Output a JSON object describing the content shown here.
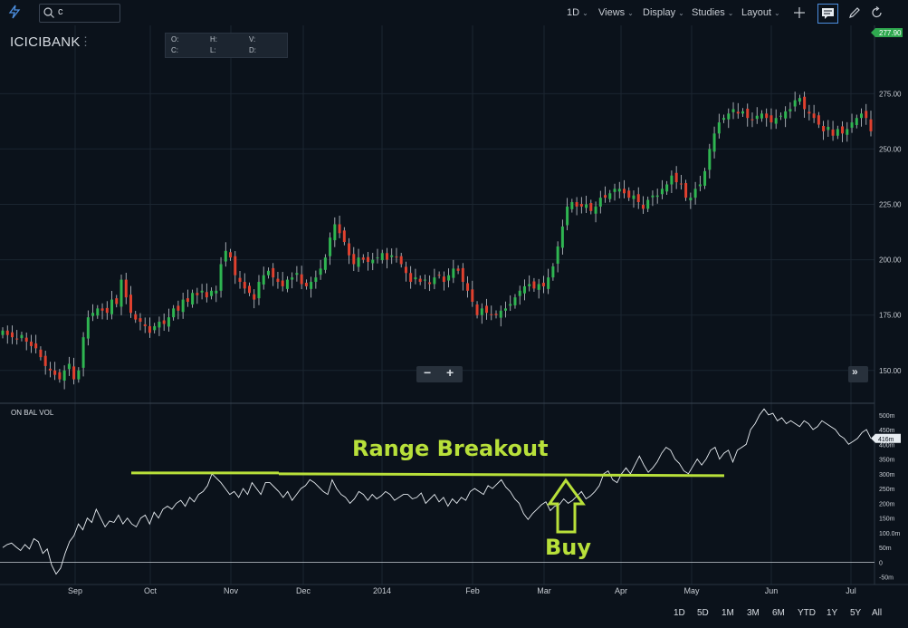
{
  "toolbar": {
    "search_value": "c",
    "interval_label": "1D",
    "views_label": "Views",
    "display_label": "Display",
    "studies_label": "Studies",
    "layout_label": "Layout"
  },
  "symbol": {
    "name": "ICICIBANK",
    "menu": "⋮"
  },
  "ohlc_labels": {
    "o": "O:",
    "h": "H:",
    "v": "V:",
    "c": "C:",
    "l": "L:",
    "d": "D:"
  },
  "indicator_label": "ON BAL VOL",
  "range_buttons": [
    "1D",
    "5D",
    "1M",
    "3M",
    "6M",
    "YTD",
    "1Y",
    "5Y",
    "All"
  ],
  "annotations": {
    "range_breakout": "Range Breakout",
    "buy": "Buy"
  },
  "colors": {
    "up": "#2fb551",
    "down": "#e0412f",
    "annotation": "#b8e03a",
    "last_price_badge": "#2fa84f",
    "background": "#0b121b"
  },
  "chart_data": [
    {
      "type": "candlestick",
      "title": "ICICIBANK",
      "x_tick_labels": [
        "Sep",
        "Oct",
        "Nov",
        "Dec",
        "2014",
        "Feb",
        "Mar",
        "Apr",
        "May",
        "Jun",
        "Jul"
      ],
      "y_tick_labels": [
        "150.00",
        "175.00",
        "200.00",
        "225.00",
        "250.00",
        "275.00"
      ],
      "ylim": [
        136,
        305
      ],
      "last_price_label": "277.90",
      "grid": true,
      "closes": [
        168,
        166,
        165,
        164,
        166,
        163,
        161,
        160,
        156,
        152,
        150,
        148,
        146,
        150,
        153,
        146,
        150,
        165,
        174,
        176,
        178,
        177,
        176,
        182,
        180,
        191,
        183,
        176,
        173,
        172,
        170,
        167,
        170,
        172,
        171,
        174,
        178,
        177,
        182,
        181,
        185,
        184,
        186,
        183,
        186,
        186,
        198,
        204,
        201,
        193,
        190,
        187,
        185,
        182,
        190,
        193,
        195,
        192,
        190,
        188,
        191,
        192,
        194,
        189,
        188,
        190,
        192,
        196,
        201,
        210,
        216,
        212,
        208,
        202,
        198,
        201,
        200,
        199,
        200,
        201,
        203,
        200,
        202,
        201,
        198,
        194,
        190,
        192,
        190,
        191,
        189,
        192,
        193,
        190,
        193,
        196,
        195,
        190,
        186,
        181,
        175,
        178,
        176,
        175,
        175,
        177,
        178,
        180,
        183,
        186,
        188,
        189,
        187,
        189,
        188,
        192,
        197,
        206,
        215,
        224,
        226,
        224,
        224,
        225,
        222,
        224,
        228,
        228,
        230,
        232,
        232,
        230,
        228,
        229,
        226,
        223,
        227,
        229,
        229,
        232,
        234,
        238,
        235,
        234,
        228,
        228,
        232,
        234,
        240,
        250,
        257,
        262,
        264,
        266,
        268,
        266,
        267,
        264,
        263,
        265,
        266,
        264,
        262,
        264,
        265,
        267,
        268,
        272,
        273,
        268,
        266,
        264,
        261,
        258,
        260,
        256,
        259,
        257,
        259,
        262,
        264,
        266,
        264,
        258
      ]
    },
    {
      "type": "line",
      "title": "ON BAL VOL",
      "y_tick_labels": [
        "-50m",
        "0",
        "50m",
        "100.0m",
        "150m",
        "200m",
        "250m",
        "300m",
        "350m",
        "400m",
        "450m",
        "500m"
      ],
      "ylim": [
        -60,
        530
      ],
      "last_value_label": "416m",
      "range_breakout_level": 300,
      "values": [
        50,
        60,
        65,
        52,
        40,
        60,
        45,
        80,
        70,
        30,
        45,
        -10,
        -40,
        -20,
        30,
        70,
        90,
        130,
        110,
        150,
        135,
        180,
        150,
        120,
        140,
        135,
        160,
        130,
        150,
        130,
        120,
        150,
        160,
        130,
        170,
        150,
        180,
        190,
        180,
        200,
        210,
        190,
        220,
        205,
        230,
        240,
        260,
        300,
        285,
        270,
        250,
        230,
        240,
        220,
        250,
        230,
        270,
        250,
        230,
        270,
        270,
        255,
        240,
        220,
        240,
        210,
        230,
        250,
        260,
        280,
        270,
        255,
        240,
        230,
        280,
        250,
        230,
        220,
        200,
        215,
        240,
        230,
        210,
        230,
        215,
        225,
        240,
        230,
        210,
        220,
        230,
        230,
        215,
        220,
        235,
        200,
        215,
        230,
        205,
        220,
        190,
        215,
        200,
        220,
        210,
        240,
        250,
        240,
        230,
        260,
        250,
        265,
        280,
        255,
        240,
        215,
        200,
        165,
        145,
        165,
        180,
        195,
        205,
        175,
        190,
        195,
        215,
        200,
        210,
        225,
        240,
        215,
        225,
        240,
        260,
        300,
        310,
        280,
        270,
        300,
        320,
        300,
        330,
        360,
        330,
        305,
        320,
        340,
        370,
        390,
        380,
        350,
        335,
        310,
        300,
        325,
        350,
        330,
        350,
        380,
        390,
        350,
        370,
        380,
        340,
        380,
        390,
        400,
        450,
        470,
        500,
        520,
        500,
        505,
        480,
        490,
        470,
        480,
        470,
        460,
        480,
        470,
        450,
        460,
        480,
        470,
        460,
        450,
        430,
        420,
        400,
        410,
        420,
        440,
        450,
        420
      ]
    }
  ]
}
